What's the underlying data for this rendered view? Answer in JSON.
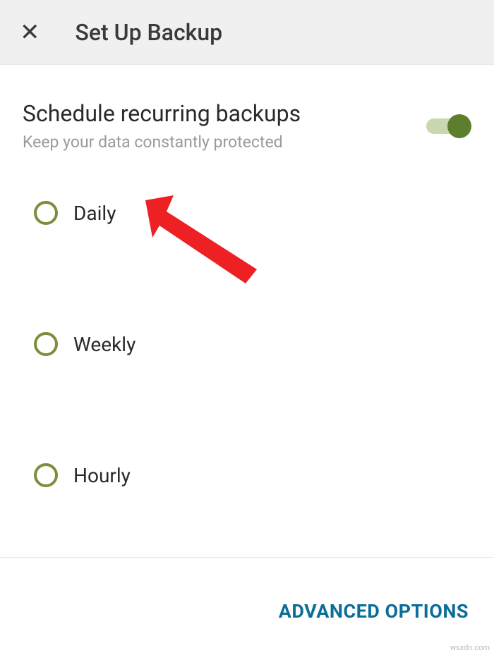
{
  "header": {
    "title": "Set Up Backup"
  },
  "schedule": {
    "title": "Schedule recurring backups",
    "subtitle": "Keep your data constantly protected",
    "toggle_on": true
  },
  "options": [
    {
      "label": "Daily"
    },
    {
      "label": "Weekly"
    },
    {
      "label": "Hourly"
    }
  ],
  "footer": {
    "advanced_label": "ADVANCED OPTIONS"
  },
  "watermark": "wsxdn.com",
  "colors": {
    "accent": "#5d7e2c",
    "radio_border": "#7a8e3e",
    "link": "#0b6e99",
    "arrow": "#ed2024"
  }
}
